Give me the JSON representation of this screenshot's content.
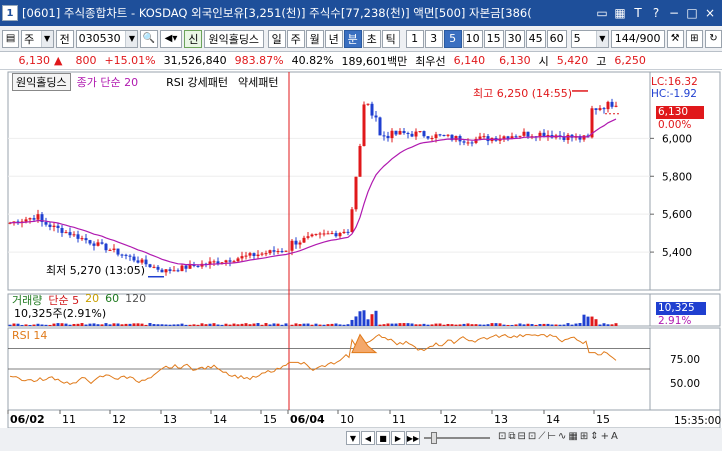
{
  "title": {
    "num": "1",
    "text": "[0601] 주식종합차트 - KOSDAQ 외국인보유[3,251(천)] 주식수[77,238(천)] 액면[500] 자본금[386("
  },
  "toolbar": {
    "market": "주",
    "prev": "전",
    "code": "030530",
    "stock_name": "원익홀딩스",
    "shin": "신",
    "periods": [
      "일",
      "주",
      "월",
      "년",
      "분",
      "초",
      "틱"
    ],
    "active_period": "분",
    "intervals": [
      "1",
      "3",
      "5",
      "10",
      "15",
      "30",
      "45",
      "60"
    ],
    "active_interval": "5",
    "count": "5",
    "range": "144/900"
  },
  "info": {
    "price": "6,130",
    "change": "800",
    "change_pct": "+15.01%",
    "volume": "31,526,840",
    "vol_ratio": "983.87%",
    "turnover": "40.82%",
    "amount": "189,601백만",
    "pref_label": "최우선",
    "pref_value": "6,140",
    "bid": "6,130",
    "open_label": "시",
    "open": "5,420",
    "high_label": "고",
    "high": "6,250"
  },
  "legend": {
    "name": "원익홀딩스",
    "ma": "종가 단순 20",
    "rsi_pattern": "RSI 강세패턴",
    "weak_pattern": "약세패턴",
    "volume_title": "거래량",
    "volume_ma": "단순 5",
    "v20": "20",
    "v60": "60",
    "v120": "120",
    "volume_value": "10,325주(2.91%)",
    "rsi_title": "RSI 14"
  },
  "annotations": {
    "high": "최고 6,250 (14:55)",
    "low": "최저 5,270 (13:05)"
  },
  "right_axis": {
    "lc": "LC:16.32",
    "hc": "HC:-1.92",
    "price_tag": "6,130",
    "pct_tag": "0.00%",
    "ticks": [
      "6,000",
      "5,800",
      "5,600",
      "5,400"
    ],
    "vol_tag": "10,325",
    "vol_pct": "2.91%",
    "rsi_ticks": [
      "75.00",
      "50.00"
    ]
  },
  "x_axis": {
    "labels": [
      "06/02",
      "11",
      "12",
      "13",
      "14",
      "15",
      "06/04",
      "10",
      "11",
      "12",
      "13",
      "14",
      "15"
    ],
    "time": "15:35:00"
  },
  "colors": {
    "up": "#e0181b",
    "down": "#1f3fd0",
    "ma": "#b01ab0",
    "rsi": "#e07a1a",
    "divider": "#e0181b"
  },
  "chart_data": {
    "type": "candlestick",
    "ylim": [
      5200,
      6350
    ],
    "ma_label": "종가 단순 20",
    "high_point": 6250,
    "low_point": 5270,
    "last": 6130
  }
}
